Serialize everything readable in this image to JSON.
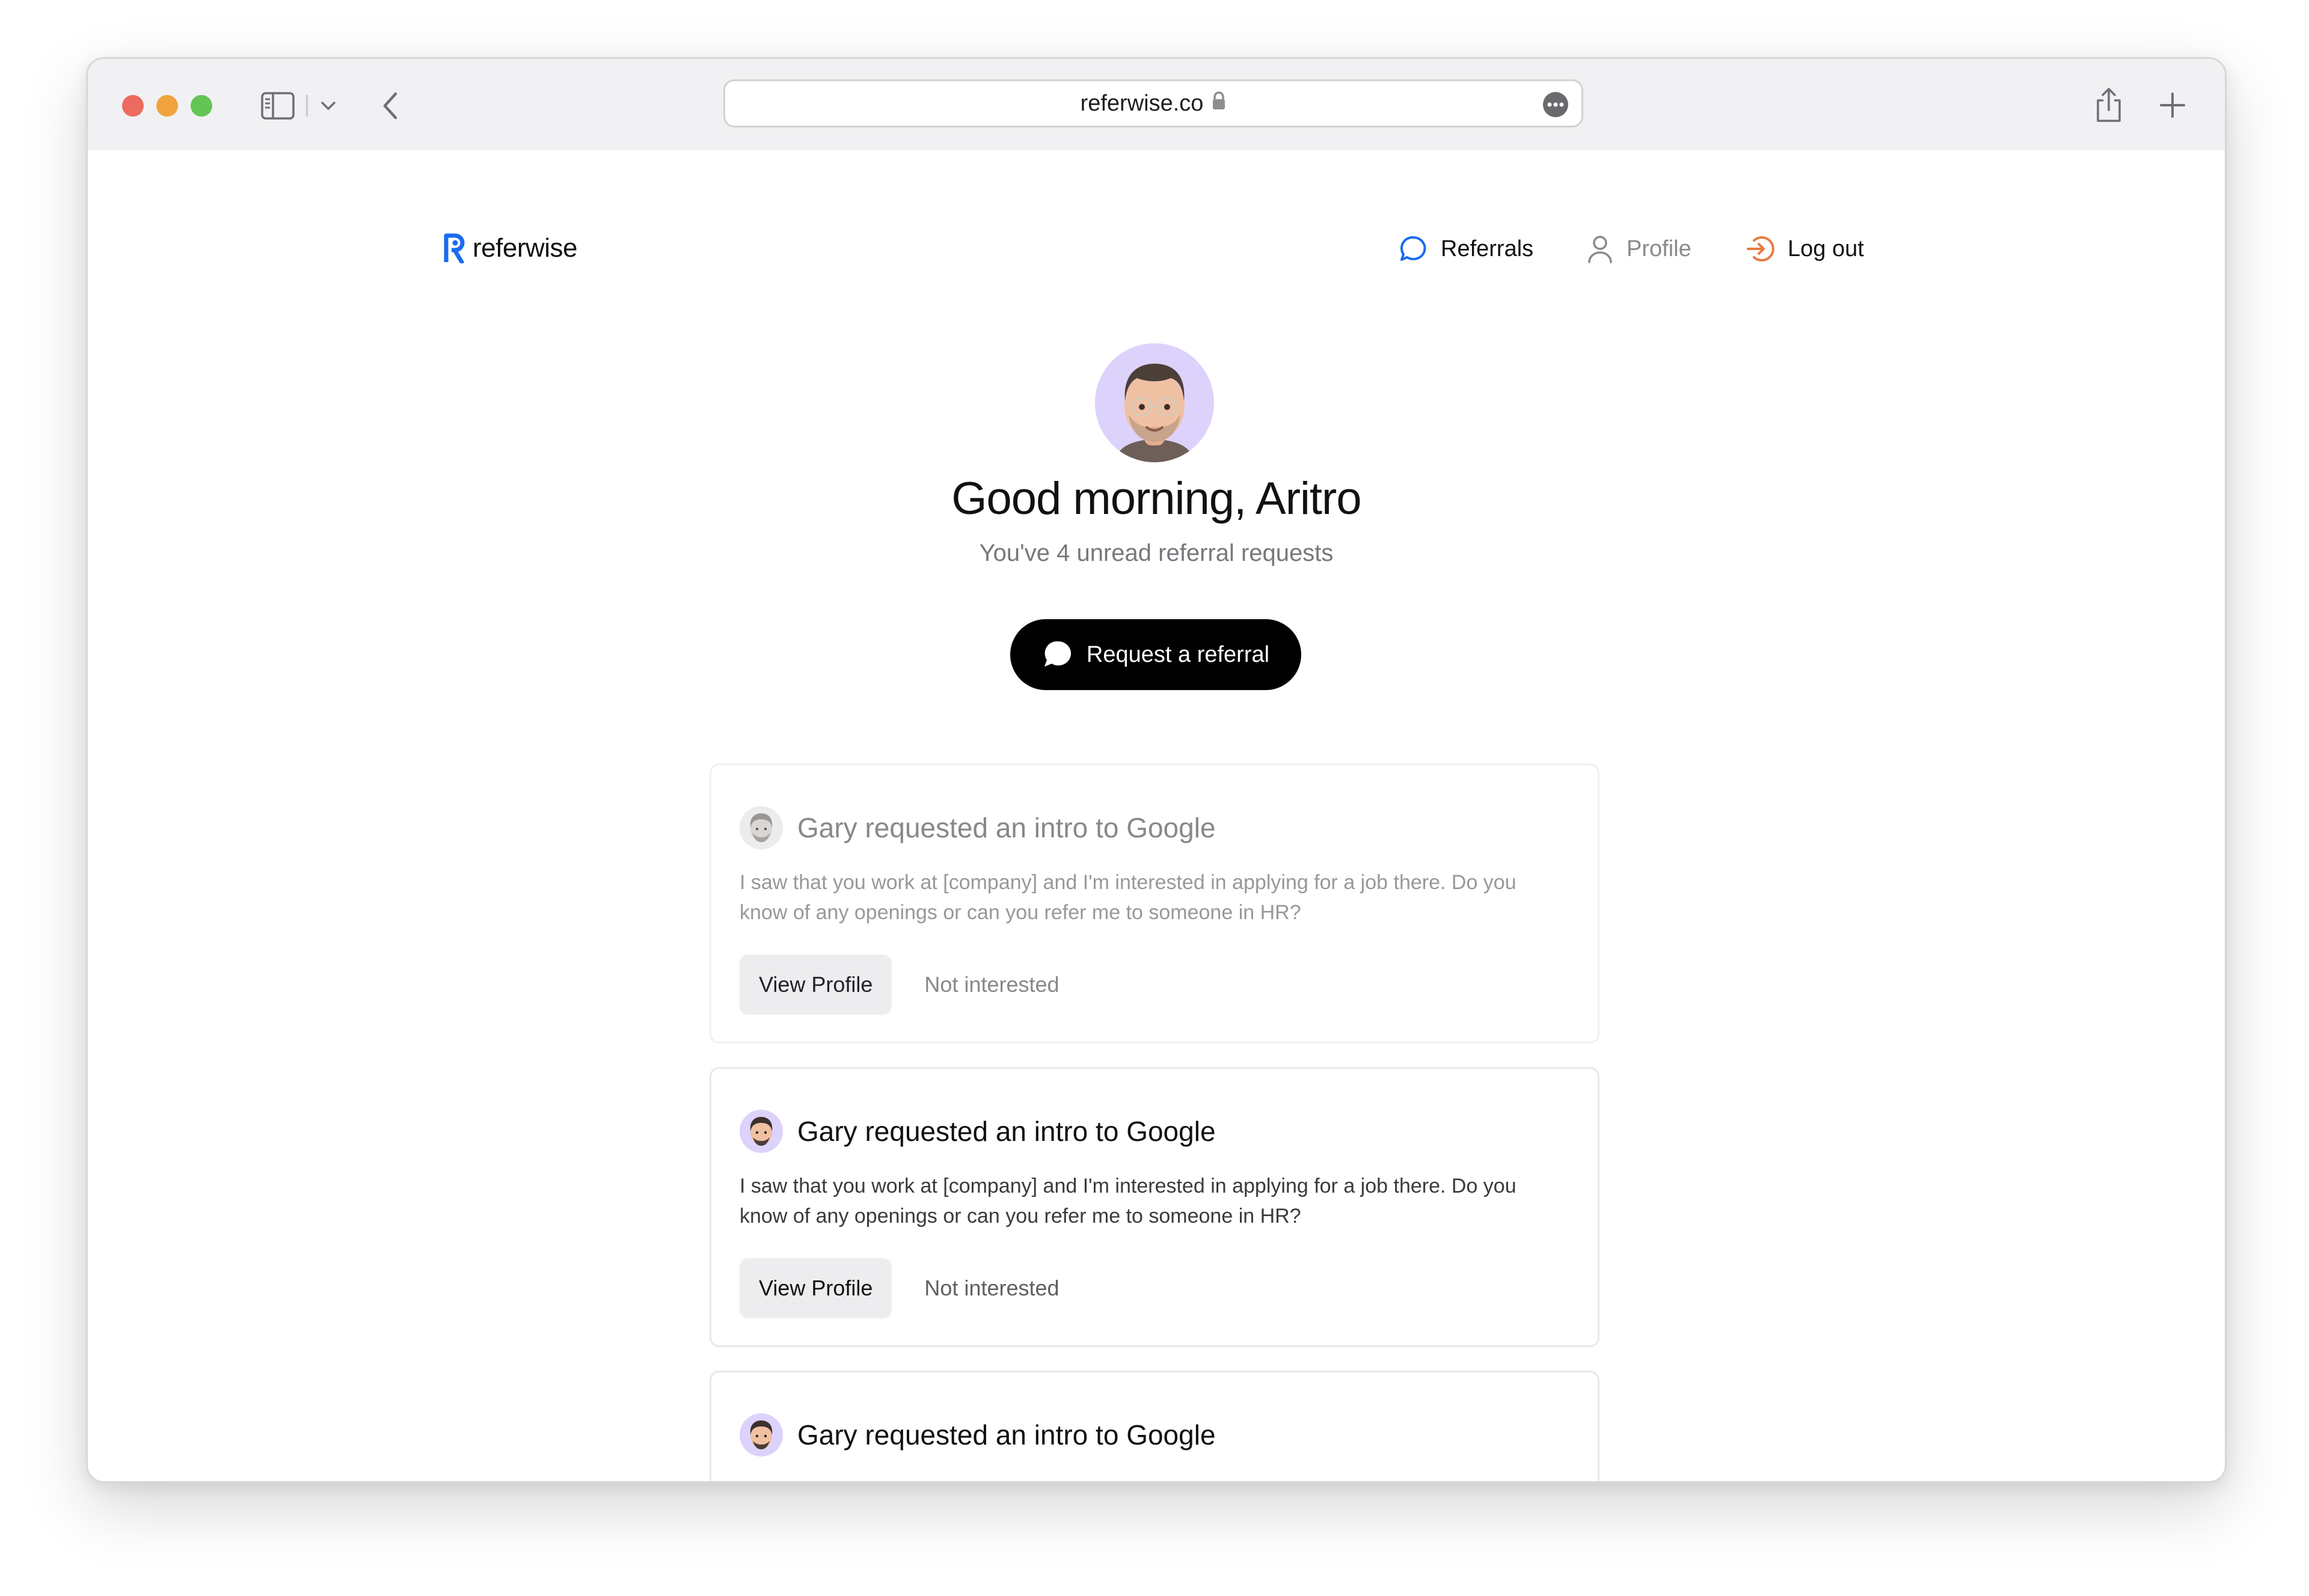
{
  "browser": {
    "url": "referwise.co"
  },
  "header": {
    "logo_text": "referwise",
    "nav": {
      "referrals": "Referrals",
      "profile": "Profile",
      "logout": "Log out"
    }
  },
  "hero": {
    "greeting": "Good morning, Aritro",
    "subtitle": "You've 4 unread referral requests",
    "cta_label": "Request a referral"
  },
  "requests": [
    {
      "title": "Gary requested an intro to Google",
      "message": "I saw that you work at [company] and I'm interested in applying for a job there. Do you know of any openings or can you refer me to someone in HR?",
      "view_label": "View Profile",
      "dismiss_label": "Not interested",
      "state": "read"
    },
    {
      "title": "Gary requested an intro to Google",
      "message": "I saw that you work at [company] and I'm interested in applying for a job there. Do you know of any openings or can you refer me to someone in HR?",
      "view_label": "View Profile",
      "dismiss_label": "Not interested",
      "state": "unread"
    },
    {
      "title": "Gary requested an intro to Google",
      "state": "unread"
    }
  ],
  "colors": {
    "brand_blue": "#1a6cf0",
    "logout_orange": "#e8793f",
    "avatar_bg": "#ddd2fb",
    "cta_bg": "#000000"
  },
  "icons": {
    "traffic_lights": [
      "close-dot",
      "minimize-dot",
      "zoom-dot"
    ],
    "toolbar": [
      "sidebar-icon",
      "chevron-down-icon",
      "back-arrow-icon",
      "lock-icon",
      "more-icon",
      "share-icon",
      "plus-icon"
    ],
    "nav": [
      "chat-bubble-icon",
      "user-icon",
      "logout-icon"
    ]
  }
}
